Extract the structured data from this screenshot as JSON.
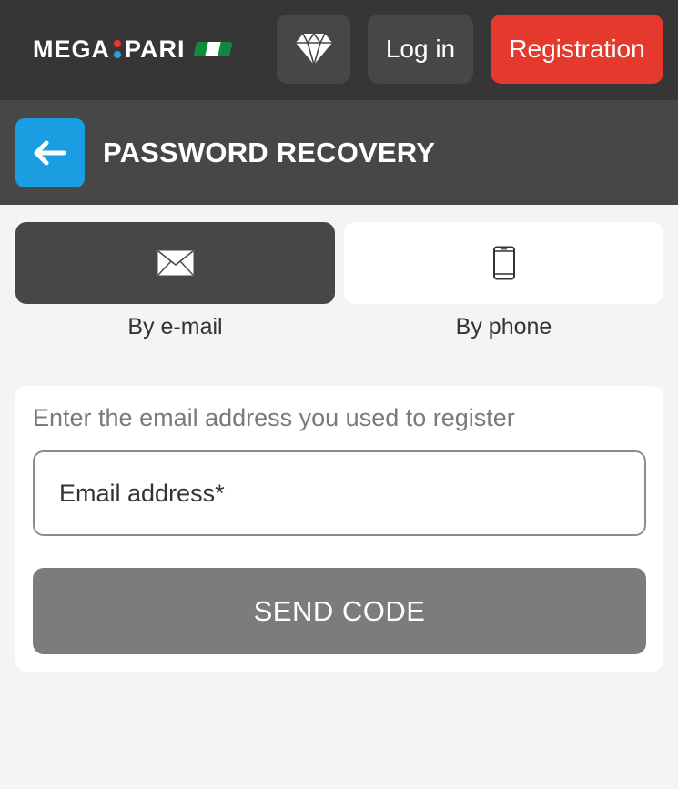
{
  "header": {
    "logo_left": "MEGA",
    "logo_right": "PARI",
    "flag_colors": [
      "#0f8a3c",
      "#ffffff",
      "#0f8a3c"
    ],
    "login_label": "Log in",
    "register_label": "Registration",
    "diamond_icon": "diamond-icon"
  },
  "subheader": {
    "title": "PASSWORD RECOVERY",
    "back_icon": "arrow-left-icon"
  },
  "tabs": [
    {
      "label": "By e-mail",
      "icon": "envelope-icon",
      "active": true
    },
    {
      "label": "By phone",
      "icon": "smartphone-icon",
      "active": false
    }
  ],
  "form": {
    "instruction": "Enter the email address you used to register",
    "email_placeholder": "Email address*",
    "email_value": "",
    "send_label": "SEND CODE"
  },
  "colors": {
    "topbar": "#363636",
    "subbar": "#474747",
    "accent_blue": "#1b9de1",
    "register_red": "#e5392e",
    "send_button_disabled": "#7c7c7c",
    "background": "#f4f4f4"
  }
}
